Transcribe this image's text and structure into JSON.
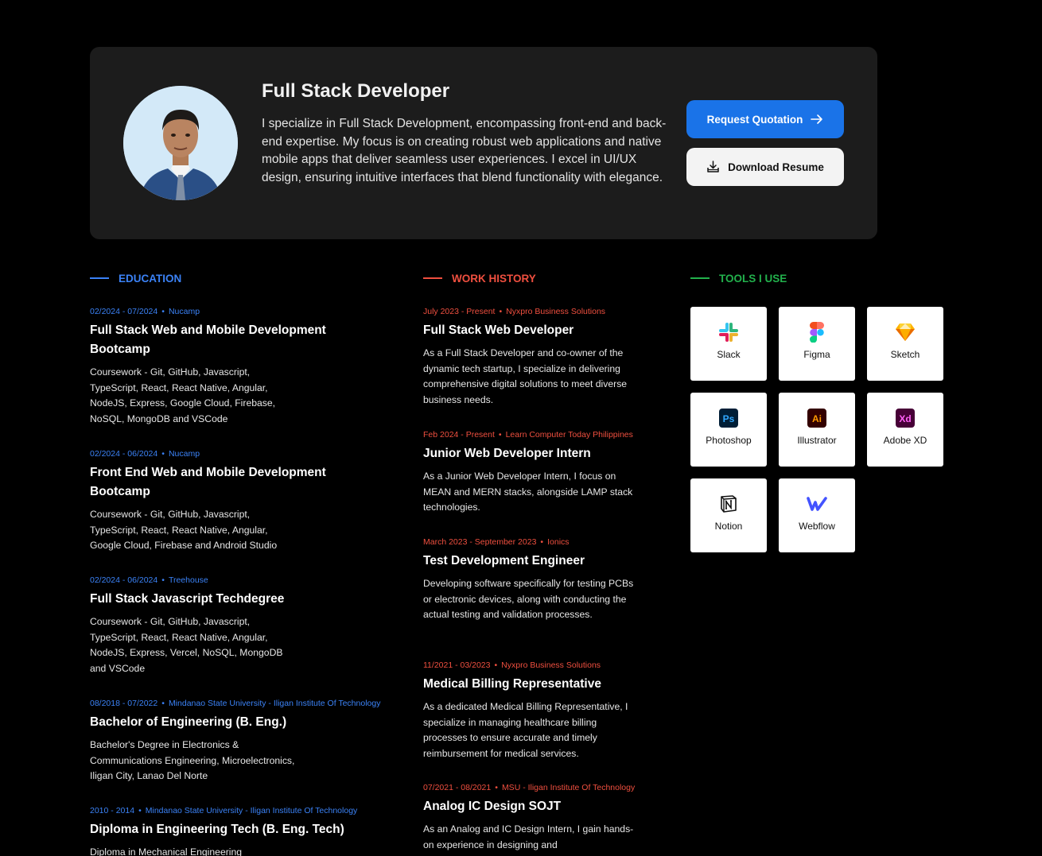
{
  "hero": {
    "title": "Full Stack Developer",
    "description": "I specialize in Full Stack Development, encompassing front-end and back-end expertise. My focus is on creating robust web applications and native mobile apps that deliver seamless user experiences. I excel in UI/UX design, ensuring intuitive interfaces that blend functionality with elegance.",
    "primary_button": "Request Quotation",
    "secondary_button": "Download Resume",
    "accent": "#1a73e8"
  },
  "education": {
    "heading": "EDUCATION",
    "color": "#3b82f6",
    "items": [
      {
        "date": "02/2024 - 07/2024",
        "org": "Nucamp",
        "title": "Full Stack Web and Mobile Development Bootcamp",
        "description": "Coursework - Git, GitHub, Javascript, TypeScript, React, React Native, Angular, NodeJS, Express, Google Cloud, Firebase, NoSQL, MongoDB and VSCode"
      },
      {
        "date": "02/2024 - 06/2024",
        "org": "Nucamp",
        "title": "Front End Web and Mobile Development Bootcamp",
        "description": "Coursework  - Git, GitHub, Javascript, TypeScript, React, React Native, Angular, Google Cloud, Firebase and Android Studio"
      },
      {
        "date": "02/2024 - 06/2024",
        "org": "Treehouse",
        "title": "Full Stack Javascript Techdegree",
        "description": "Coursework - Git, GitHub, Javascript, TypeScript, React, React Native, Angular, NodeJS, Express, Vercel, NoSQL, MongoDB and VSCode"
      },
      {
        "date": "08/2018 - 07/2022",
        "org": "Mindanao State University - Iligan Institute Of Technology",
        "title": "Bachelor of Engineering (B. Eng.)",
        "description": "Bachelor's Degree in Electronics & Communications Engineering, Microelectronics, Iligan City, Lanao Del Norte"
      },
      {
        "date": "2010 - 2014",
        "org": "Mindanao State University - Iligan Institute Of Technology",
        "title": "Diploma in Engineering Tech (B. Eng. Tech)",
        "description": "Diploma in Mechanical Engineering"
      }
    ]
  },
  "work": {
    "heading": "WORK HISTORY",
    "color": "#ef4f3f",
    "items": [
      {
        "date": "July 2023 - Present",
        "org": "Nyxpro Business Solutions",
        "title": "Full Stack Web Developer",
        "description": "As a Full Stack Developer and co-owner of the dynamic tech startup, I specialize in delivering comprehensive digital solutions to meet diverse business needs."
      },
      {
        "date": "Feb 2024 - Present",
        "org": "Learn Computer Today Philippines",
        "title": "Junior Web Developer Intern",
        "description": "As a Junior Web Developer Intern, I focus on MEAN and MERN stacks, alongside LAMP stack technologies."
      },
      {
        "date": "March 2023 - September 2023",
        "org": "Ionics",
        "title": "Test Development Engineer",
        "description": "Developing software specifically for testing PCBs or electronic devices, along with conducting the actual testing and validation processes."
      },
      {
        "date": "11/2021 - 03/2023",
        "org": "Nyxpro Business Solutions",
        "title": "Medical Billing Representative",
        "description": "As a dedicated Medical Billing Representative, I specialize in managing healthcare billing processes to ensure accurate and timely reimbursement for medical services."
      },
      {
        "date": "07/2021 - 08/2021",
        "org": "MSU - Iligan Institute Of Technology",
        "title": "Analog IC Design SOJT",
        "description": "As an Analog and IC Design Intern, I gain hands-on experience in designing and"
      }
    ]
  },
  "tools": {
    "heading": "TOOLS I USE",
    "color": "#22b14c",
    "items": [
      {
        "label": "Slack",
        "icon": "slack-icon"
      },
      {
        "label": "Figma",
        "icon": "figma-icon"
      },
      {
        "label": "Sketch",
        "icon": "sketch-icon"
      },
      {
        "label": "Photoshop",
        "icon": "photoshop-icon"
      },
      {
        "label": "Illustrator",
        "icon": "illustrator-icon"
      },
      {
        "label": "Adobe XD",
        "icon": "adobe-xd-icon"
      },
      {
        "label": "Notion",
        "icon": "notion-icon"
      },
      {
        "label": "Webflow",
        "icon": "webflow-icon"
      }
    ]
  }
}
